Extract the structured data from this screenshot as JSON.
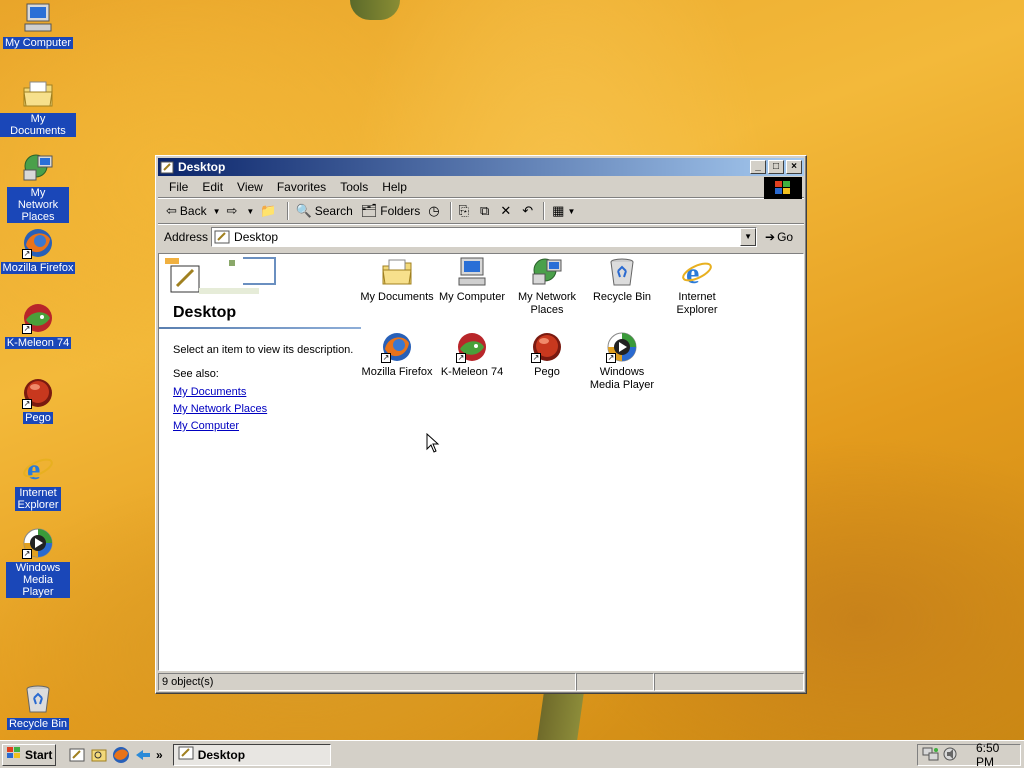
{
  "desktop": {
    "icons": [
      {
        "label": "My Computer",
        "icon": "my-computer-icon"
      },
      {
        "label": "My Documents",
        "icon": "my-documents-icon"
      },
      {
        "label": "My Network Places",
        "icon": "network-places-icon"
      },
      {
        "label": "Mozilla Firefox",
        "icon": "firefox-icon"
      },
      {
        "label": "K-Meleon 74",
        "icon": "k-meleon-icon"
      },
      {
        "label": "Pego",
        "icon": "pego-icon"
      },
      {
        "label": "Internet Explorer",
        "icon": "internet-explorer-icon"
      },
      {
        "label": "Windows Media Player",
        "icon": "media-player-icon"
      },
      {
        "label": "Recycle Bin",
        "icon": "recycle-bin-icon"
      }
    ]
  },
  "window": {
    "title": "Desktop",
    "menu": [
      "File",
      "Edit",
      "View",
      "Favorites",
      "Tools",
      "Help"
    ],
    "toolbar": {
      "back": "Back",
      "search": "Search",
      "folders": "Folders"
    },
    "address": {
      "label": "Address",
      "value": "Desktop",
      "go": "Go"
    },
    "left_pane": {
      "title": "Desktop",
      "description": "Select an item to view its description.",
      "see_also": "See also:",
      "links": [
        "My Documents",
        "My Network Places",
        "My Computer"
      ]
    },
    "items": [
      {
        "label": "My Documents",
        "icon": "my-documents-icon"
      },
      {
        "label": "My Computer",
        "icon": "my-computer-icon"
      },
      {
        "label": "My Network Places",
        "icon": "network-places-icon"
      },
      {
        "label": "Recycle Bin",
        "icon": "recycle-bin-icon"
      },
      {
        "label": "Internet Explorer",
        "icon": "internet-explorer-icon"
      },
      {
        "label": "Mozilla Firefox",
        "icon": "firefox-icon"
      },
      {
        "label": "K-Meleon 74",
        "icon": "k-meleon-icon"
      },
      {
        "label": "Pego",
        "icon": "pego-icon"
      },
      {
        "label": "Windows Media Player",
        "icon": "media-player-icon"
      }
    ],
    "status": "9 object(s)"
  },
  "taskbar": {
    "start": "Start",
    "task": "Desktop",
    "chevron": "»",
    "clock": "6:50 PM"
  }
}
